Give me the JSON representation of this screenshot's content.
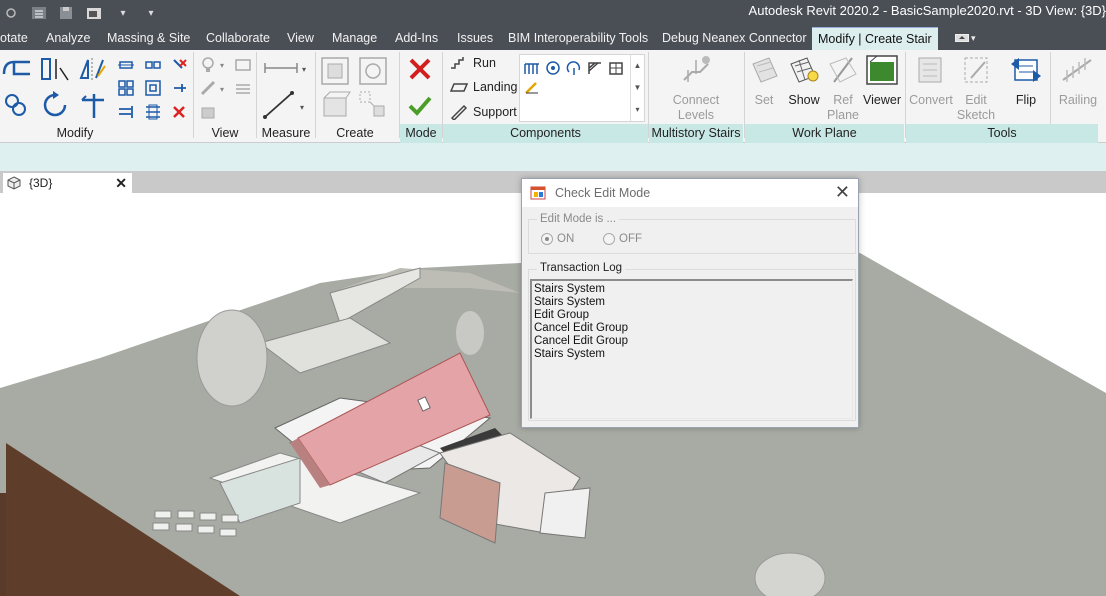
{
  "window": {
    "title": "Autodesk Revit 2020.2 - BasicSample2020.rvt - 3D View: {3D}"
  },
  "tabs": [
    {
      "label": "otate",
      "active": false
    },
    {
      "label": "Analyze",
      "active": false
    },
    {
      "label": "Massing & Site",
      "active": false
    },
    {
      "label": "Collaborate",
      "active": false
    },
    {
      "label": "View",
      "active": false
    },
    {
      "label": "Manage",
      "active": false
    },
    {
      "label": "Add-Ins",
      "active": false
    },
    {
      "label": "Issues",
      "active": false
    },
    {
      "label": "BIM Interoperability Tools",
      "active": false
    },
    {
      "label": "Debug Neanex Connector",
      "active": false
    },
    {
      "label": "Modify | Create Stair",
      "active": true
    }
  ],
  "ribbon": {
    "panels": {
      "modify": "Modify",
      "view": "View",
      "measure": "Measure",
      "create": "Create",
      "mode": "Mode",
      "components": "Components",
      "multistory": "Multistory Stairs",
      "workplane": "Work Plane",
      "tools": "Tools"
    },
    "components": {
      "run": "Run",
      "landing": "Landing",
      "support": "Support"
    },
    "multistory": {
      "connect_levels": "Connect Levels",
      "connect_line1": "Connect",
      "connect_line2": "Levels"
    },
    "workplane": {
      "set": "Set",
      "show": "Show",
      "ref_plane_line1": "Ref",
      "ref_plane_line2": "Plane",
      "viewer": "Viewer"
    },
    "tools": {
      "convert": "Convert",
      "edit_sketch_line1": "Edit",
      "edit_sketch_line2": "Sketch",
      "flip": "Flip",
      "railing": "Railing"
    }
  },
  "view_tab": {
    "label": "{3D}"
  },
  "dialog": {
    "title": "Check Edit Mode",
    "edit_mode_group": "Edit Mode is ...",
    "option_on": "ON",
    "option_off": "OFF",
    "selected": "ON",
    "log_group": "Transaction Log",
    "log": [
      "Stairs System",
      "Stairs System",
      "Edit Group",
      "Cancel Edit Group",
      "Cancel Edit Group",
      "Stairs System"
    ]
  },
  "colors": {
    "titlebar": "#4a4e55",
    "active_tab": "#ddeeee",
    "panel_title_teal": "#c8e8e6",
    "roof": "#e4a3a6",
    "terrain": "#a9aca5"
  },
  "icons": {
    "qat": [
      "revit-logo-icon",
      "undo-list-icon",
      "save-icon",
      "sync-icon",
      "dropdown-icon"
    ],
    "cancel": "cancel-red-x-icon",
    "finish": "finish-green-check-icon",
    "close": "close-icon"
  }
}
